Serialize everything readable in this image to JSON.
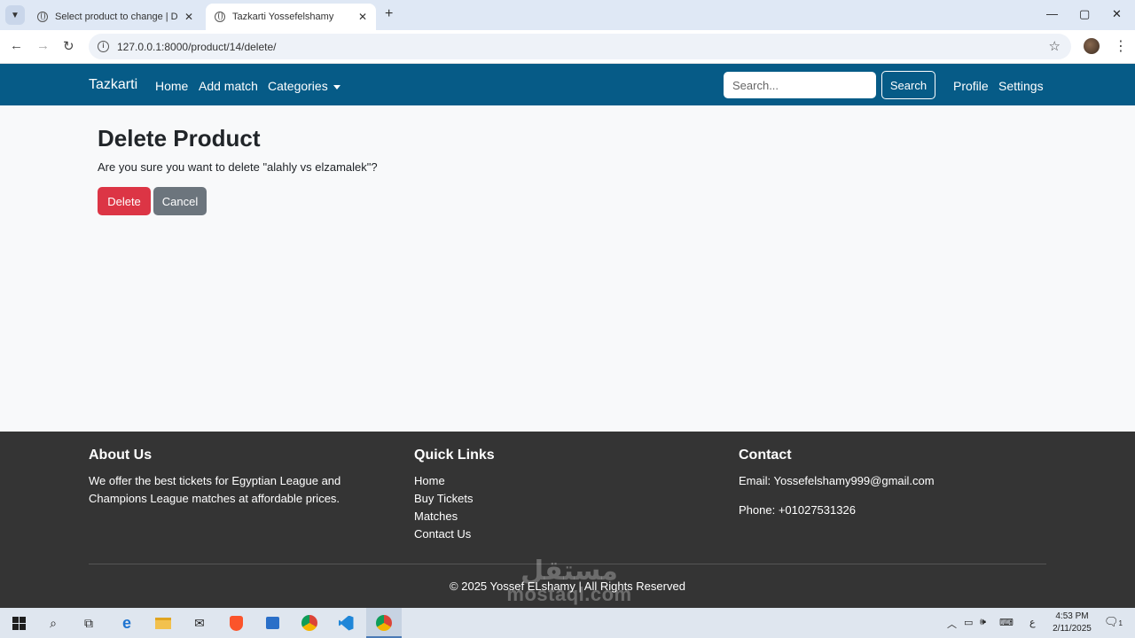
{
  "browser": {
    "tabs": [
      {
        "title": "Select product to change | Django site admin"
      },
      {
        "title": "Tazkarti Yossefelshamy"
      }
    ],
    "url": "127.0.0.1:8000/product/14/delete/"
  },
  "navbar": {
    "brand": "Tazkarti",
    "links": [
      "Home",
      "Add match",
      "Categories"
    ],
    "search_placeholder": "Search...",
    "search_button": "Search",
    "right_links": [
      "Profile",
      "Settings"
    ]
  },
  "main": {
    "title": "Delete Product",
    "confirm_text": "Are you sure you want to delete \"alahly vs elzamalek\"?",
    "delete_button": "Delete",
    "cancel_button": "Cancel"
  },
  "footer": {
    "about": {
      "heading": "About Us",
      "text": "We offer the best tickets for Egyptian League and Champions League matches at affordable prices."
    },
    "quick_links": {
      "heading": "Quick Links",
      "items": [
        "Home",
        "Buy Tickets",
        "Matches",
        "Contact Us"
      ]
    },
    "contact": {
      "heading": "Contact",
      "email": "Email: Yossefelshamy999@gmail.com",
      "phone": "Phone: +01027531326"
    },
    "copyright": "© 2025 Yossef ELshamy | All Rights Reserved",
    "watermark_ar": "مستقل",
    "watermark_latin": "mostaql.com"
  },
  "taskbar": {
    "input_indicator": "ع",
    "time": "4:53 PM",
    "date": "2/11/2025",
    "notification_count": "1"
  },
  "colors": {
    "navbar": "#065b87",
    "delete": "#dc3545",
    "cancel": "#6c757d",
    "footer": "#343434"
  }
}
